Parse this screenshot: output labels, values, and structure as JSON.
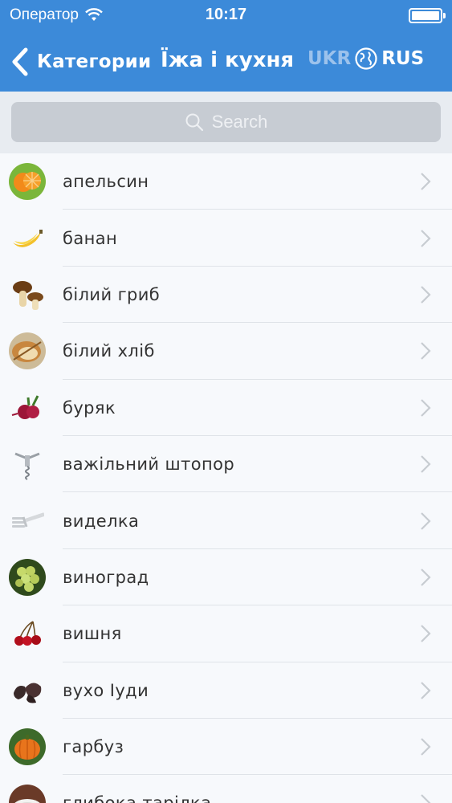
{
  "status": {
    "carrier": "Оператор",
    "time": "10:17"
  },
  "nav": {
    "back_label": "Категории",
    "title": "Їжа і кухня",
    "lang_left": "UKR",
    "lang_right": "RUS"
  },
  "search": {
    "placeholder": "Search"
  },
  "items": [
    {
      "label": "апельсин",
      "icon": "orange-icon"
    },
    {
      "label": "банан",
      "icon": "banana-icon"
    },
    {
      "label": "білий гриб",
      "icon": "mushroom-icon"
    },
    {
      "label": "білий хліб",
      "icon": "bread-icon"
    },
    {
      "label": "буряк",
      "icon": "beet-icon"
    },
    {
      "label": "важільний штопор",
      "icon": "corkscrew-icon"
    },
    {
      "label": "виделка",
      "icon": "fork-icon"
    },
    {
      "label": "виноград",
      "icon": "grapes-icon"
    },
    {
      "label": "вишня",
      "icon": "cherry-icon"
    },
    {
      "label": "вухо Іуди",
      "icon": "wood-ear-mushroom-icon"
    },
    {
      "label": "гарбуз",
      "icon": "pumpkin-icon"
    },
    {
      "label": "глибока тарілка",
      "icon": "plate-icon"
    }
  ],
  "colors": {
    "navbar": "#3c8ad9",
    "lang_inactive": "#9cc2ec",
    "search_bg": "#c7ccd3",
    "row_bg": "#f7f9fc"
  }
}
